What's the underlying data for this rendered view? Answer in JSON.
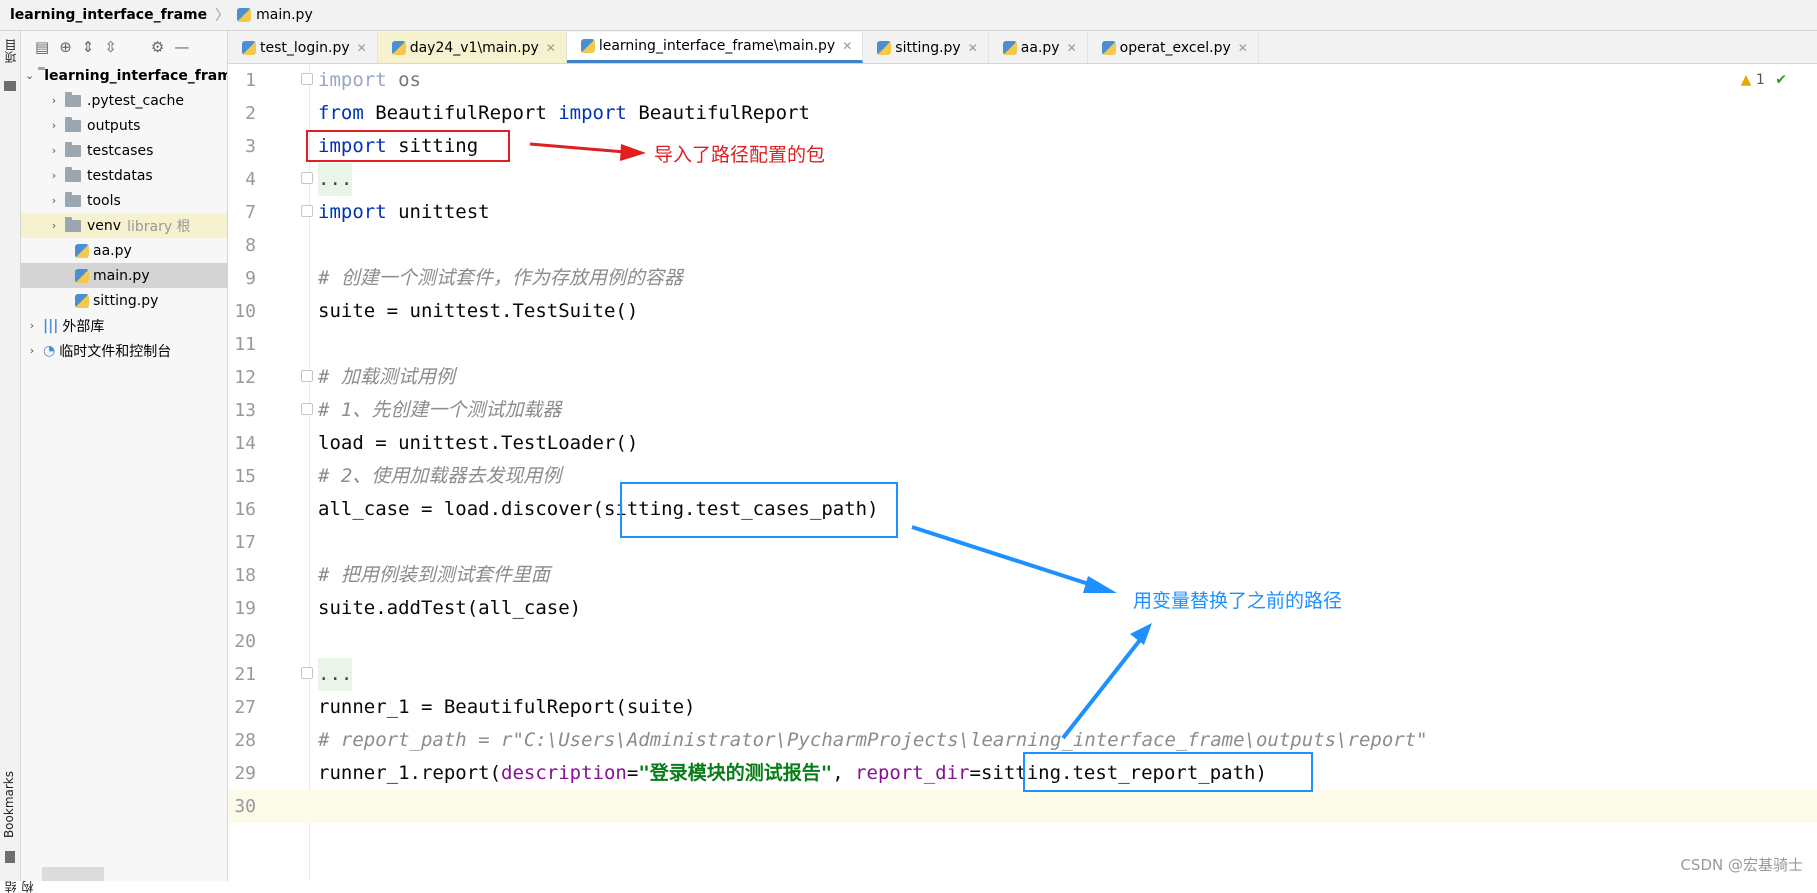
{
  "breadcrumb": {
    "project": "learning_interface_frame",
    "file": "main.py"
  },
  "left_strip": {
    "top_label": "项目",
    "bookmarks_label": "Bookmarks",
    "structure_label": "结构"
  },
  "sidebar": {
    "root": "learning_interface_frame",
    "items": [
      {
        "label": ".pytest_cache",
        "type": "folder"
      },
      {
        "label": "outputs",
        "type": "folder"
      },
      {
        "label": "testcases",
        "type": "folder"
      },
      {
        "label": "testdatas",
        "type": "folder"
      },
      {
        "label": "tools",
        "type": "folder"
      },
      {
        "label": "venv",
        "suffix": "library 根",
        "type": "folder"
      },
      {
        "label": "aa.py",
        "type": "file"
      },
      {
        "label": "main.py",
        "type": "file",
        "selected": true
      },
      {
        "label": "sitting.py",
        "type": "file"
      }
    ],
    "external_libs": "外部库",
    "scratches": "临时文件和控制台"
  },
  "tabs": [
    {
      "label": "test_login.py"
    },
    {
      "label": "day24_v1\\main.py",
      "highlighted": true
    },
    {
      "label": "learning_interface_frame\\main.py",
      "active": true
    },
    {
      "label": "sitting.py"
    },
    {
      "label": "aa.py"
    },
    {
      "label": "operat_excel.py"
    }
  ],
  "inspection": {
    "warnings": "1"
  },
  "code_lines": {
    "n1": "1",
    "n2": "2",
    "n3": "3",
    "n4": "4",
    "n7": "7",
    "n8": "8",
    "n9": "9",
    "n10": "10",
    "n11": "11",
    "n12": "12",
    "n13": "13",
    "n14": "14",
    "n15": "15",
    "n16": "16",
    "n17": "17",
    "n18": "18",
    "n19": "19",
    "n20": "20",
    "n21": "21",
    "n27": "27",
    "n28": "28",
    "n29": "29",
    "n30": "30"
  },
  "code": {
    "l1_kw": "import",
    "l1_rest": " os",
    "l2_kw1": "from",
    "l2_mid": " BeautifulReport ",
    "l2_kw2": "import",
    "l2_rest": " BeautifulReport",
    "l3_kw": "import",
    "l3_rest": " sitting",
    "l4": "...",
    "l7_kw": "import",
    "l7_rest": " unittest",
    "l9": "# 创建一个测试套件，作为存放用例的容器",
    "l10": "suite = unittest.TestSuite()",
    "l12": "# 加载测试用例",
    "l13": "# 1、先创建一个测试加载器",
    "l14": "load = unittest.TestLoader()",
    "l15": "# 2、使用加载器去发现用例",
    "l16": "all_case = load.discover(sitting.test_cases_path)",
    "l18": "# 把用例装到测试套件里面",
    "l19": "suite.addTest(all_case)",
    "l21": "...",
    "l27": "runner_1 = BeautifulReport(suite)",
    "l28": "# report_path = r\"C:\\Users\\Administrator\\PycharmProjects\\learning_interface_frame\\outputs\\report\"",
    "l29_a": "runner_1.report(",
    "l29_p1": "description",
    "l29_eq": "=",
    "l29_s": "\"登录模块的测试报告\"",
    "l29_c": ", ",
    "l29_p2": "report_dir",
    "l29_b": "=sitting.test_report_path)"
  },
  "annotations": {
    "red": "导入了路径配置的包",
    "blue": "用变量替换了之前的路径"
  },
  "colors": {
    "red_annotation": "#e02020",
    "blue_annotation": "#1e90ff",
    "keyword": "#0033b3"
  },
  "watermark": "CSDN @宏基骑士"
}
